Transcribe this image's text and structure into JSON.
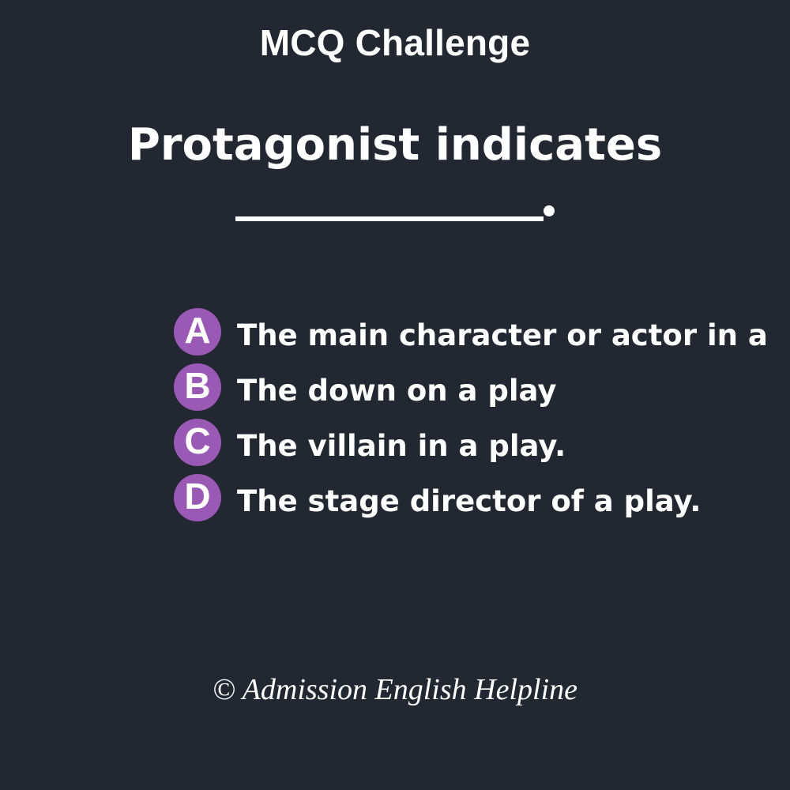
{
  "header": {
    "title": "MCQ Challenge"
  },
  "question": {
    "text": "Protagonist indicates"
  },
  "options": [
    {
      "letter": "A",
      "text": "The main character or actor in a"
    },
    {
      "letter": "B",
      "text": "The down on a play"
    },
    {
      "letter": "C",
      "text": "The villain in a play."
    },
    {
      "letter": "D",
      "text": "The stage director of a play."
    }
  ],
  "footer": {
    "text": "© Admission English Helpline"
  },
  "colors": {
    "background": "#222732",
    "badge": "#9b59b6",
    "text": "#ffffff"
  }
}
